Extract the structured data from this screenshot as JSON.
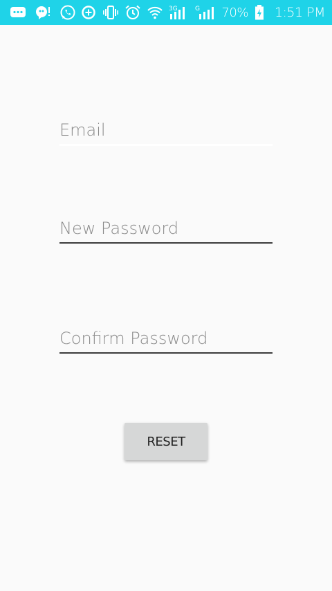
{
  "status_bar": {
    "background": "#1fd3e8",
    "left_icons": [
      "messages-icon",
      "hangouts-icon",
      "whatsapp-icon"
    ],
    "right_icons": [
      "data-saver-icon",
      "vibrate-icon",
      "alarm-icon",
      "wifi-icon",
      "signal-3g-icon",
      "signal-g-icon"
    ],
    "network_3g_label": "3G",
    "network_g_label": "G",
    "battery_percent": "70%",
    "time": "1:51 PM"
  },
  "form": {
    "email_placeholder": "Email",
    "new_password_placeholder": "New Password",
    "confirm_password_placeholder": "Confirm Password",
    "reset_label": "RESET"
  },
  "colors": {
    "status_bar": "#1fd3e8",
    "background": "#fafafa",
    "button": "#d6d7d7",
    "underline": "#3b3b3b"
  }
}
